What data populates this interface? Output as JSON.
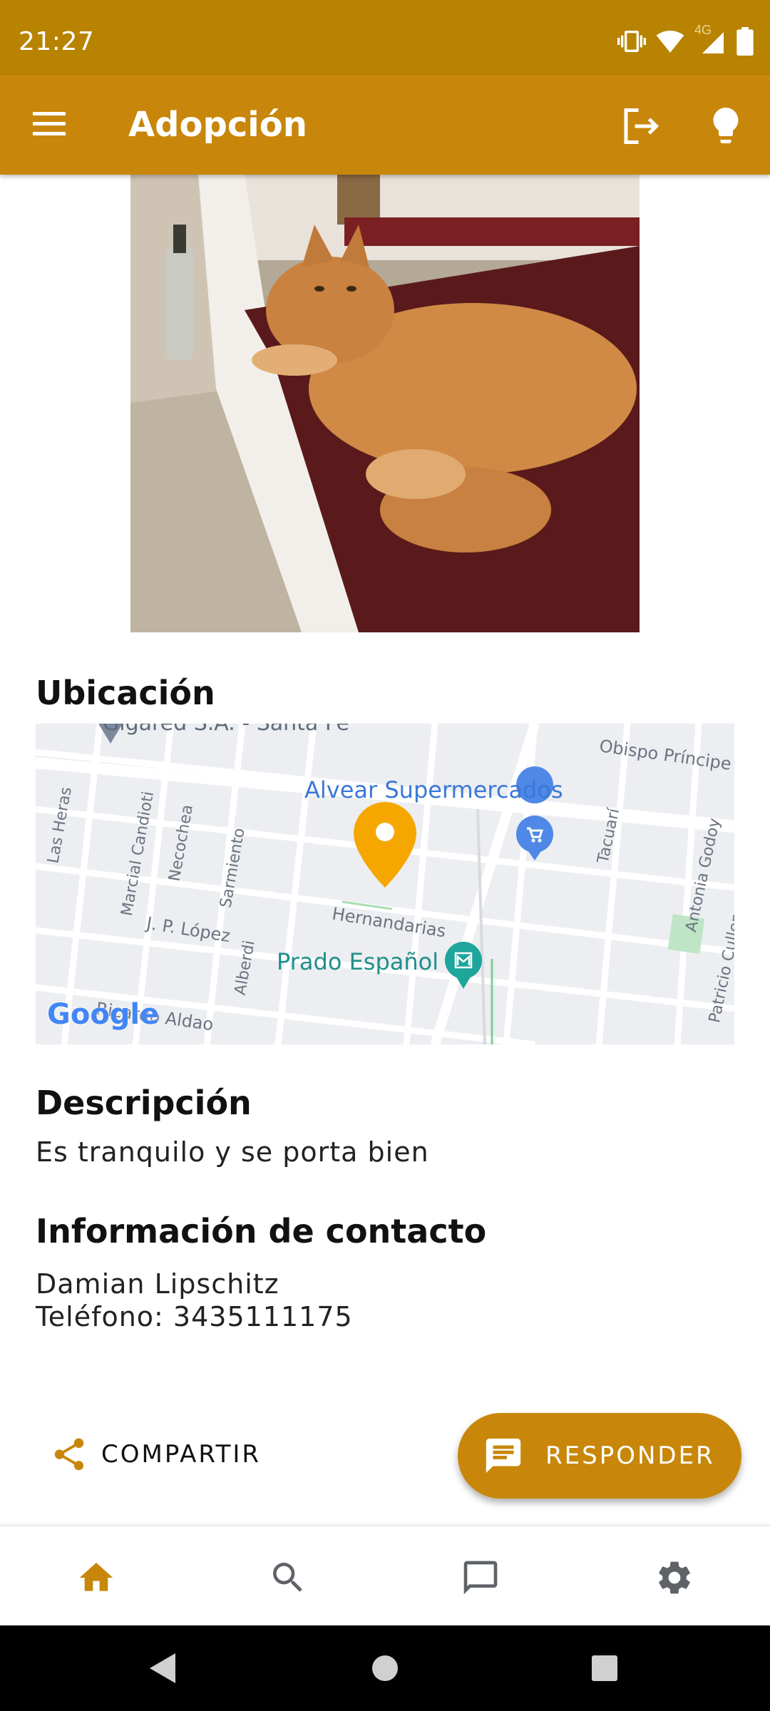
{
  "status_bar": {
    "time": "21:27",
    "network": "4G",
    "icons": [
      "vibrate-icon",
      "wifi-icon",
      "signal-icon",
      "battery-icon"
    ]
  },
  "app_bar": {
    "title": "Adopción",
    "icons": [
      "menu-icon",
      "logout-icon",
      "lightbulb-icon"
    ]
  },
  "colors": {
    "primary": "#c8870a",
    "status_bar": "#b88300",
    "marker": "#f5a700"
  },
  "location": {
    "title": "Ubicación",
    "map": {
      "poi_supermarket": "Alvear Supermercados",
      "poi_park": "Prado Español",
      "top_label": "Gigared S.A. - Santa Fe",
      "streets": [
        "Obispo Príncipe",
        "Las Heras",
        "Marcial Candioti",
        "Necochea",
        "Sarmiento",
        "Tacuarí",
        "Antonia Godoy",
        "J. P. López",
        "Hernandarias",
        "Alberdi",
        "Patricio Cullen",
        "Ricardo Aldao"
      ],
      "logo": "Google"
    }
  },
  "description": {
    "title": "Descripción",
    "text": "Es tranquilo y se porta bien"
  },
  "contact": {
    "title": "Información de contacto",
    "name": "Damian Lipschitz",
    "phone": "Teléfono: 3435111175"
  },
  "actions": {
    "share_label": "COMPARTIR",
    "reply_label": "RESPONDER"
  },
  "bottom_nav": {
    "items": [
      "home-icon",
      "search-icon",
      "chat-icon",
      "settings-icon"
    ],
    "active": "home-icon"
  },
  "system_nav": {
    "items": [
      "back-icon",
      "home-icon",
      "recents-icon"
    ]
  }
}
